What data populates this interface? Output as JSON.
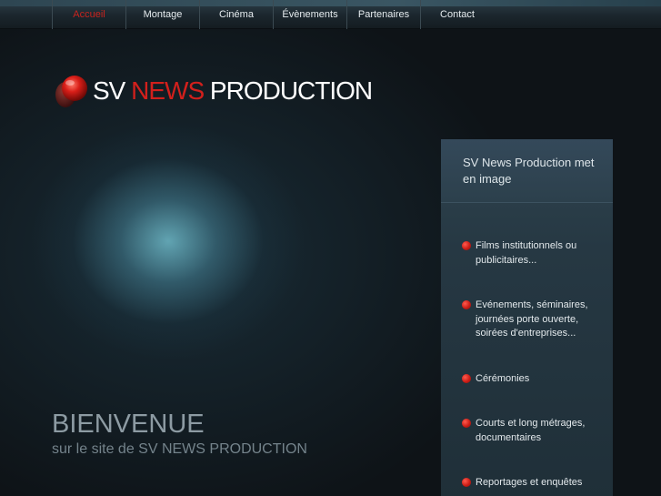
{
  "nav": {
    "items": [
      {
        "label": "Accueil",
        "active": true
      },
      {
        "label": "Montage",
        "active": false
      },
      {
        "label": "Cinéma",
        "active": false
      },
      {
        "label": "Évènements",
        "active": false
      },
      {
        "label": "Partenaires",
        "active": false
      },
      {
        "label": "Contact",
        "active": false
      }
    ]
  },
  "logo": {
    "part1": "SV",
    "part2": "NEWS",
    "part3": "PRODUCTION"
  },
  "welcome": {
    "title": "BIENVENUE",
    "subtitle": "sur le site de SV NEWS PRODUCTION"
  },
  "side_panel": {
    "title": "SV News Production met en image",
    "services": [
      "Films institutionnels ou publicitaires...",
      "Evénements, séminaires, journées porte ouverte, soirées d'entreprises...",
      "Cérémonies",
      "Courts et long métrages, documentaires",
      "Reportages et enquêtes"
    ]
  },
  "colors": {
    "accent_red": "#d2201c",
    "nav_bg": "#1b262d",
    "page_bg": "#0e1317"
  }
}
